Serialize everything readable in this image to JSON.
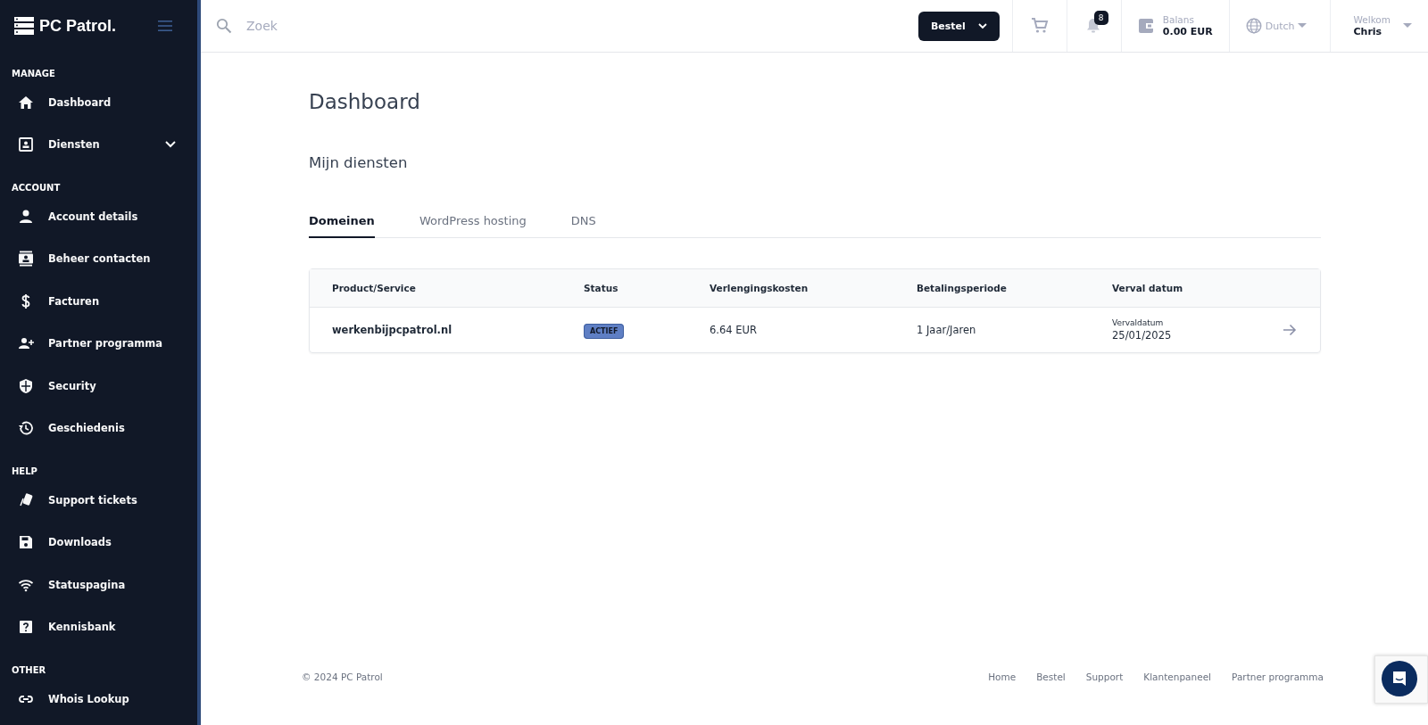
{
  "sidebar": {
    "logo": "PC Patrol.",
    "sections": [
      {
        "title": "MANAGE",
        "items": [
          {
            "label": "Dashboard",
            "expandable": false
          },
          {
            "label": "Diensten",
            "expandable": true
          }
        ]
      },
      {
        "title": "ACCOUNT",
        "items": [
          {
            "label": "Account details",
            "expandable": false
          },
          {
            "label": "Beheer contacten",
            "expandable": false
          },
          {
            "label": "Facturen",
            "expandable": false
          },
          {
            "label": "Partner programma",
            "expandable": false
          },
          {
            "label": "Security",
            "expandable": false
          },
          {
            "label": "Geschiedenis",
            "expandable": false
          }
        ]
      },
      {
        "title": "HELP",
        "items": [
          {
            "label": "Support tickets",
            "expandable": false
          },
          {
            "label": "Downloads",
            "expandable": false
          },
          {
            "label": "Statuspagina",
            "expandable": false
          },
          {
            "label": "Kennisbank",
            "expandable": false
          }
        ]
      },
      {
        "title": "OTHER",
        "items": [
          {
            "label": "Whois Lookup",
            "expandable": false
          }
        ]
      }
    ]
  },
  "topbar": {
    "search": {
      "placeholder": "Zoek"
    },
    "order_button": "Bestel",
    "notifications": "8",
    "balance": {
      "label": "Balans",
      "value": "0.00 EUR"
    },
    "language": "Dutch",
    "user": {
      "greeting": "Welkom",
      "name": "Chris"
    }
  },
  "page": {
    "title": "Dashboard",
    "subtitle": "Mijn diensten",
    "tabs": [
      {
        "label": "Domeinen",
        "selected": true
      },
      {
        "label": "WordPress hosting",
        "selected": false
      },
      {
        "label": "DNS",
        "selected": false
      }
    ],
    "table": {
      "columns": [
        "Product/Service",
        "Status",
        "Verlengingskosten",
        "Betalingsperiode",
        "Verval datum"
      ],
      "rows": [
        {
          "product": "werkenbijpcpatrol.nl",
          "status": "ACTIEF",
          "cost": "6.64 EUR",
          "period": "1 Jaar/Jaren",
          "expiry_label": "Vervaldatum",
          "expiry": "25/01/2025"
        }
      ]
    }
  },
  "footer": {
    "copyright": "© 2024 PC Patrol",
    "links": [
      "Home",
      "Bestel",
      "Support",
      "Klantenpaneel",
      "Partner programma"
    ]
  }
}
